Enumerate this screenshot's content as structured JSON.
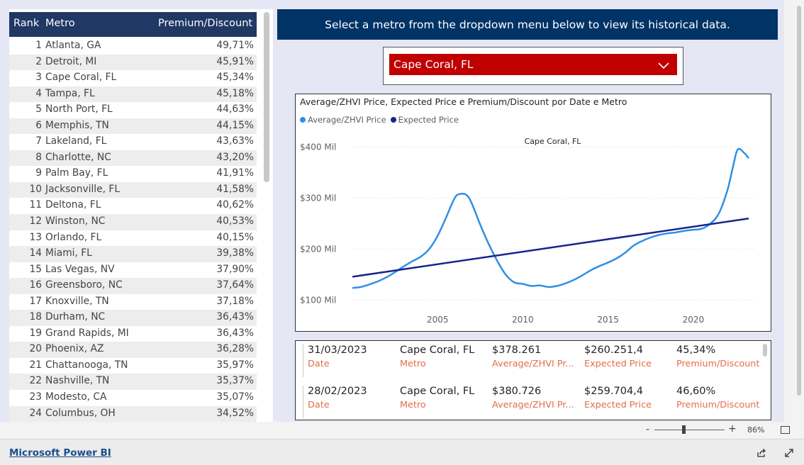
{
  "table": {
    "headers": {
      "rank": "Rank",
      "metro": "Metro",
      "pd": "Premium/Discount"
    },
    "rows": [
      {
        "rank": "1",
        "metro": "Atlanta, GA",
        "pd": "49,71%"
      },
      {
        "rank": "2",
        "metro": "Detroit, MI",
        "pd": "45,91%"
      },
      {
        "rank": "3",
        "metro": "Cape Coral, FL",
        "pd": "45,34%"
      },
      {
        "rank": "4",
        "metro": "Tampa, FL",
        "pd": "45,18%"
      },
      {
        "rank": "5",
        "metro": "North Port, FL",
        "pd": "44,63%"
      },
      {
        "rank": "6",
        "metro": "Memphis, TN",
        "pd": "44,15%"
      },
      {
        "rank": "7",
        "metro": "Lakeland, FL",
        "pd": "43,63%"
      },
      {
        "rank": "8",
        "metro": "Charlotte, NC",
        "pd": "43,20%"
      },
      {
        "rank": "9",
        "metro": "Palm Bay, FL",
        "pd": "41,91%"
      },
      {
        "rank": "10",
        "metro": "Jacksonville, FL",
        "pd": "41,58%"
      },
      {
        "rank": "11",
        "metro": "Deltona, FL",
        "pd": "40,62%"
      },
      {
        "rank": "12",
        "metro": "Winston, NC",
        "pd": "40,53%"
      },
      {
        "rank": "13",
        "metro": "Orlando, FL",
        "pd": "40,15%"
      },
      {
        "rank": "14",
        "metro": "Miami, FL",
        "pd": "39,38%"
      },
      {
        "rank": "15",
        "metro": "Las Vegas, NV",
        "pd": "37,90%"
      },
      {
        "rank": "16",
        "metro": "Greensboro, NC",
        "pd": "37,64%"
      },
      {
        "rank": "17",
        "metro": "Knoxville, TN",
        "pd": "37,18%"
      },
      {
        "rank": "18",
        "metro": "Durham, NC",
        "pd": "36,43%"
      },
      {
        "rank": "19",
        "metro": "Grand Rapids, MI",
        "pd": "36,43%"
      },
      {
        "rank": "20",
        "metro": "Phoenix, AZ",
        "pd": "36,28%"
      },
      {
        "rank": "21",
        "metro": "Chattanooga, TN",
        "pd": "35,97%"
      },
      {
        "rank": "22",
        "metro": "Nashville, TN",
        "pd": "35,37%"
      },
      {
        "rank": "23",
        "metro": "Modesto, CA",
        "pd": "35,07%"
      },
      {
        "rank": "24",
        "metro": "Columbus, OH",
        "pd": "34,52%"
      }
    ]
  },
  "banner": {
    "text": "Select a metro from the dropdown menu below to view its historical data."
  },
  "slicer": {
    "selected": "Cape Coral, FL",
    "chevron_icon": "chevron-down-icon",
    "color": "#c00000"
  },
  "chart_data": {
    "type": "line",
    "title": "Average/ZHVI Price, Expected Price e Premium/Discount por Date e Metro",
    "subtitle": "Cape Coral, FL",
    "legend": [
      "Average/ZHVI Price",
      "Expected Price"
    ],
    "legend_position": "top-left",
    "colors": {
      "Average/ZHVI Price": "#2f8fe6",
      "Expected Price": "#1a238c"
    },
    "xlabel": "",
    "ylabel": "",
    "x_ticks": [
      2005,
      2010,
      2015,
      2020
    ],
    "y_ticks": [
      100,
      200,
      300,
      400
    ],
    "y_tick_labels": [
      "$100 Mil",
      "$200 Mil",
      "$300 Mil",
      "$400 Mil"
    ],
    "xlim": [
      2000,
      2023.5
    ],
    "ylim": [
      80,
      420
    ],
    "grid": true,
    "series": [
      {
        "name": "Average/ZHVI Price",
        "x": [
          2000.0,
          2000.5,
          2001.0,
          2001.5,
          2002.0,
          2002.5,
          2003.0,
          2003.5,
          2004.0,
          2004.5,
          2005.0,
          2005.5,
          2006.0,
          2006.3,
          2006.7,
          2007.0,
          2007.5,
          2008.0,
          2008.5,
          2009.0,
          2009.5,
          2010.0,
          2010.5,
          2011.0,
          2011.5,
          2012.0,
          2012.5,
          2013.0,
          2013.5,
          2014.0,
          2014.5,
          2015.0,
          2015.5,
          2016.0,
          2016.5,
          2017.0,
          2017.5,
          2018.0,
          2018.5,
          2019.0,
          2019.5,
          2020.0,
          2020.5,
          2021.0,
          2021.5,
          2022.0,
          2022.3,
          2022.6,
          2023.0,
          2023.25
        ],
        "values": [
          124,
          126,
          131,
          137,
          145,
          155,
          166,
          176,
          185,
          200,
          226,
          262,
          300,
          308,
          306,
          290,
          248,
          210,
          177,
          150,
          135,
          132,
          128,
          129,
          126,
          128,
          133,
          140,
          149,
          159,
          167,
          174,
          182,
          193,
          207,
          216,
          223,
          228,
          231,
          233,
          236,
          238,
          240,
          250,
          270,
          315,
          357,
          395,
          388,
          378
        ]
      },
      {
        "name": "Expected Price",
        "x": [
          2000.0,
          2023.25
        ],
        "values": [
          146,
          260
        ]
      }
    ]
  },
  "details": {
    "rows": [
      {
        "date": "31/03/2023",
        "metro": "Cape Coral, FL",
        "avg": "$378.261",
        "expected": "$260.251,4",
        "pd": "45,34%"
      },
      {
        "date": "28/02/2023",
        "metro": "Cape Coral, FL",
        "avg": "$380.726",
        "expected": "$259.704,4",
        "pd": "46,60%"
      }
    ],
    "labels": {
      "date": "Date",
      "metro": "Metro",
      "avg": "Average/ZHVI Pr...",
      "expected": "Expected Price",
      "pd": "Premium/Discount"
    },
    "label_color": "#e46c4a"
  },
  "zoom": {
    "minus": "-",
    "plus": "+",
    "level": "86%"
  },
  "footer": {
    "brand": "Microsoft Power BI",
    "share_icon": "share-icon",
    "expand_icon": "expand-icon"
  }
}
